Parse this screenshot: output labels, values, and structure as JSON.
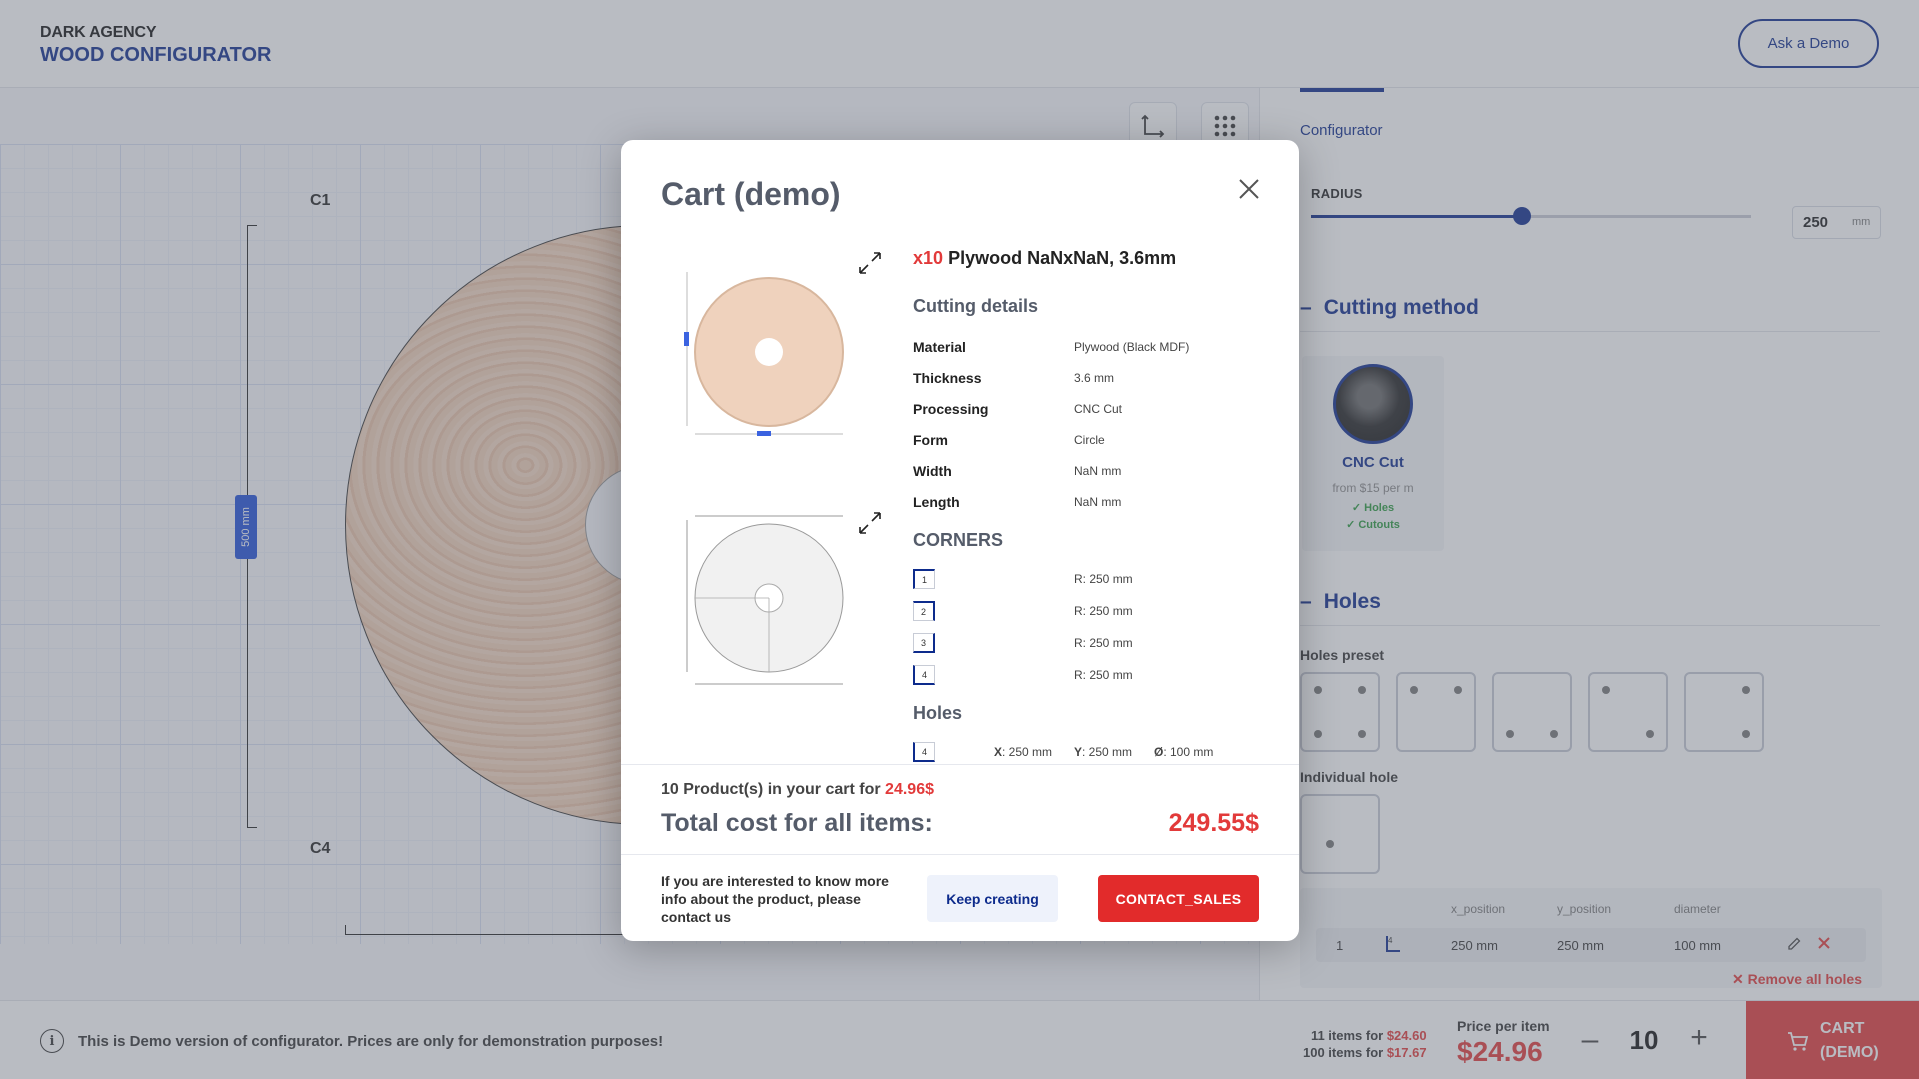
{
  "header": {
    "brand_top": "DARK AGENCY",
    "brand_bottom": "WOOD CONFIGURATOR",
    "ask_demo": "Ask a Demo"
  },
  "canvas": {
    "corner_c1": "C1",
    "corner_c4": "C4",
    "dimension_label": "500 mm"
  },
  "panel": {
    "tab": "Configurator",
    "radius": {
      "label": "RADIUS",
      "value": "250",
      "unit": "mm",
      "slider_fraction": 0.48
    },
    "cutting_method": {
      "title": "Cutting method",
      "card": {
        "name": "CNC Cut",
        "price": "from $15 per m",
        "features": [
          "✓ Holes",
          "✓ Cutouts"
        ]
      }
    },
    "holes": {
      "title": "Holes",
      "preset_label": "Holes preset",
      "individual_label": "Individual hole",
      "table": {
        "headers": [
          "x_position",
          "y_position",
          "diameter"
        ],
        "row": {
          "index": "1",
          "corner": "4",
          "x": "250 mm",
          "y": "250 mm",
          "d": "100 mm"
        }
      },
      "remove_all": "Remove all holes"
    }
  },
  "footer": {
    "demo_note": "This is Demo version of configurator. Prices are only for demonstration purposes!",
    "tier1_label": "11 items for",
    "tier1_price": "$24.60",
    "tier2_label": "100 items for",
    "tier2_price": "$17.67",
    "price_label": "Price per item",
    "price_value": "$24.96",
    "quantity": "10",
    "cart_line1": "CART",
    "cart_line2": "(DEMO)"
  },
  "modal": {
    "title": "Cart (demo)",
    "item": {
      "qty": "x10",
      "name": "Plywood NaNxNaN, 3.6mm"
    },
    "cutting_details": {
      "title": "Cutting details",
      "rows": [
        {
          "label": "Material",
          "value": "Plywood (Black MDF)"
        },
        {
          "label": "Thickness",
          "value": "3.6 mm"
        },
        {
          "label": "Processing",
          "value": "CNC Cut"
        },
        {
          "label": "Form",
          "value": "Circle"
        },
        {
          "label": "Width",
          "value": "NaN mm"
        },
        {
          "label": "Length",
          "value": "NaN mm"
        }
      ]
    },
    "corners": {
      "title": "CORNERS",
      "rows": [
        {
          "num": "1",
          "value": "R: 250 mm"
        },
        {
          "num": "2",
          "value": "R: 250 mm"
        },
        {
          "num": "3",
          "value": "R: 250 mm"
        },
        {
          "num": "4",
          "value": "R: 250 mm"
        }
      ]
    },
    "holes": {
      "title": "Holes",
      "row": {
        "num": "4",
        "x_key": "X",
        "x": ": 250 mm",
        "y_key": "Y",
        "y": ": 250 mm",
        "d_key": "Ø",
        "d": ": 100 mm"
      }
    },
    "summary": {
      "count_text": "10 Product(s) in your cart for",
      "count_price": "24.96$",
      "total_label": "Total cost for all items:",
      "total_value": "249.55$"
    },
    "footer_note": "If you are interested to know more info about the product, please contact us",
    "keep_creating": "Keep creating",
    "contact_sales": "CONTACT_SALES"
  }
}
